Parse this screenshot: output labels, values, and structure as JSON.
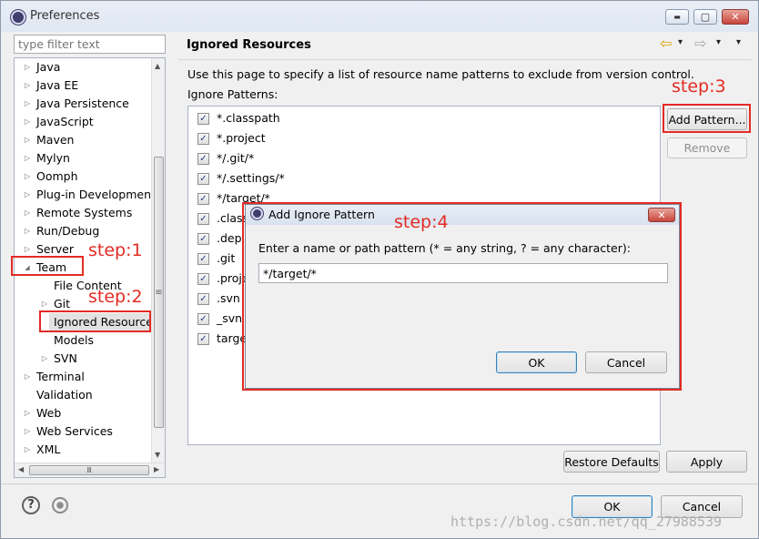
{
  "window": {
    "title": "Preferences",
    "min_glyph": "▬",
    "max_glyph": "▢",
    "close_glyph": "✕"
  },
  "filter": {
    "placeholder": "type filter text"
  },
  "tree": {
    "items": [
      {
        "label": "Java",
        "arrow": "▷"
      },
      {
        "label": "Java EE",
        "arrow": "▷"
      },
      {
        "label": "Java Persistence",
        "arrow": "▷"
      },
      {
        "label": "JavaScript",
        "arrow": "▷"
      },
      {
        "label": "Maven",
        "arrow": "▷"
      },
      {
        "label": "Mylyn",
        "arrow": "▷"
      },
      {
        "label": "Oomph",
        "arrow": "▷"
      },
      {
        "label": "Plug-in Development",
        "arrow": "▷"
      },
      {
        "label": "Remote Systems",
        "arrow": "▷"
      },
      {
        "label": "Run/Debug",
        "arrow": "▷"
      },
      {
        "label": "Server",
        "arrow": "▷"
      },
      {
        "label": "Team",
        "arrow": "◢"
      },
      {
        "label": "File Content",
        "arrow": ""
      },
      {
        "label": "Git",
        "arrow": "▷"
      },
      {
        "label": "Ignored Resources",
        "arrow": ""
      },
      {
        "label": "Models",
        "arrow": ""
      },
      {
        "label": "SVN",
        "arrow": "▷"
      },
      {
        "label": "Terminal",
        "arrow": "▷"
      },
      {
        "label": "Validation",
        "arrow": ""
      },
      {
        "label": "Web",
        "arrow": "▷"
      },
      {
        "label": "Web Services",
        "arrow": "▷"
      },
      {
        "label": "XML",
        "arrow": "▷"
      }
    ],
    "hscroll_grip": "Ⅲ",
    "vscroll_grip": "≡"
  },
  "page": {
    "title": "Ignored Resources",
    "description": "Use this page to specify a list of resource name patterns to exclude from version control.",
    "patterns_label": "Ignore Patterns:",
    "patterns": [
      "*.classpath",
      "*.project",
      "*/.git/*",
      "*/.settings/*",
      "*/target/*",
      ".classpath",
      ".deployables",
      ".git",
      ".project",
      ".svn",
      "_svn",
      "target"
    ],
    "add_pattern": "Add Pattern...",
    "remove": "Remove",
    "restore_defaults": "Restore Defaults",
    "apply": "Apply"
  },
  "nav": {
    "back": "⇦",
    "forward": "⇨",
    "dropdown": "▾"
  },
  "checkmark": "✓",
  "dialog": {
    "title": "Add Ignore Pattern",
    "prompt": "Enter a name or path pattern (* = any string, ? = any character):",
    "value": "*/target/*",
    "ok": "OK",
    "cancel": "Cancel",
    "close_glyph": "✕"
  },
  "footer": {
    "help": "?",
    "ok": "OK",
    "cancel": "Cancel"
  },
  "annotations": {
    "step1": "step:1",
    "step2": "step:2",
    "step3": "step:3",
    "step4": "step:4"
  },
  "watermark": "https://blog.csdn.net/qq_27988539",
  "colors": {
    "annotation_red": "#e32b24",
    "default_button_border": "#3c7fb1",
    "check_color": "#2a3c8c"
  }
}
